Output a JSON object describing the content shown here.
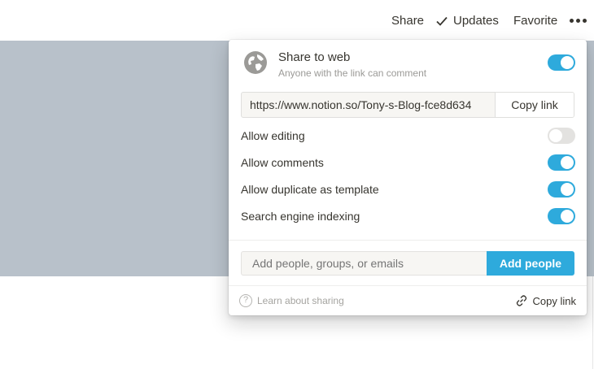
{
  "topbar": {
    "share": "Share",
    "updates": "Updates",
    "favorite": "Favorite"
  },
  "share_popover": {
    "share_to_web": {
      "title": "Share to web",
      "subtitle": "Anyone with the link can comment",
      "enabled": true
    },
    "link": {
      "url": "https://www.notion.so/Tony-s-Blog-fce8d634",
      "copy_label": "Copy link"
    },
    "options": [
      {
        "label": "Allow editing",
        "enabled": false
      },
      {
        "label": "Allow comments",
        "enabled": true
      },
      {
        "label": "Allow duplicate as template",
        "enabled": true
      },
      {
        "label": "Search engine indexing",
        "enabled": true
      }
    ],
    "invite": {
      "placeholder": "Add people, groups, or emails",
      "button": "Add people"
    },
    "footer": {
      "learn": "Learn about sharing",
      "copy_link": "Copy link"
    }
  },
  "colors": {
    "accent": "#2eaadc",
    "cover": "#b8c1ca",
    "toggle_off": "#e3e2e0"
  }
}
